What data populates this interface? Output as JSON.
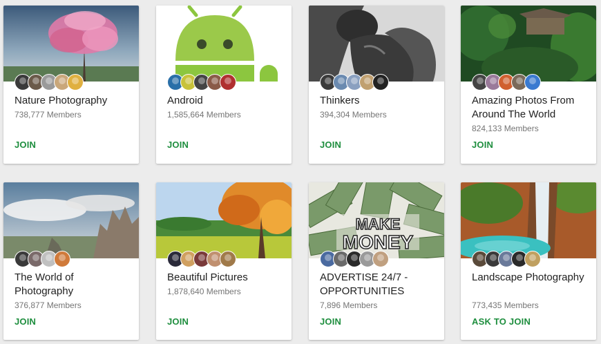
{
  "communities": [
    {
      "name": "Nature Photography",
      "members": "738,777 Members",
      "action": "JOIN",
      "image": "pink-blossom-tree",
      "avatar_colors": [
        "#3a3a3a",
        "#6b5a4a",
        "#9a9a9a",
        "#c9a77a",
        "#e0b040"
      ]
    },
    {
      "name": "Android",
      "members": "1,585,664 Members",
      "action": "JOIN",
      "image": "android-robot",
      "avatar_colors": [
        "#2a6fa8",
        "#c8c23a",
        "#444444",
        "#8a5a48",
        "#b03030"
      ]
    },
    {
      "name": "Thinkers",
      "members": "394,304 Members",
      "action": "JOIN",
      "image": "thinker-statue",
      "avatar_colors": [
        "#3a3a3a",
        "#6a8ab0",
        "#8aa0c0",
        "#c0a070",
        "#222222"
      ]
    },
    {
      "name": "Amazing Photos From Around The World",
      "members": "824,133 Members",
      "action": "JOIN",
      "image": "jungle-treehouse",
      "avatar_colors": [
        "#444444",
        "#9a7a9a",
        "#d06030",
        "#7a6a5a",
        "#3a7ad0"
      ]
    },
    {
      "name": "The World of Photography",
      "members": "376,877 Members",
      "action": "JOIN",
      "image": "mountain-clouds",
      "avatar_colors": [
        "#3a3a3a",
        "#7a6a6a",
        "#c0c0c0",
        "#d07a3a"
      ]
    },
    {
      "name": "Beautiful Pictures",
      "members": "1,878,640 Members",
      "action": "JOIN",
      "image": "autumn-tree",
      "avatar_colors": [
        "#2a2a3a",
        "#d0a060",
        "#7a3a3a",
        "#c09070",
        "#a07a4a"
      ]
    },
    {
      "name": "ADVERTISE 24/7 - OPPORTUNITIES",
      "members": "7,896 Members",
      "action": "JOIN",
      "image": "make-money",
      "avatar_colors": [
        "#4a6aa0",
        "#6a6a6a",
        "#2a2a2a",
        "#9a9a9a",
        "#c0a080"
      ]
    },
    {
      "name": "Landscape Photography",
      "members": "773,435 Members",
      "action": "ASK TO JOIN",
      "image": "waterfall",
      "avatar_colors": [
        "#5a4a3a",
        "#3a3a3a",
        "#6a7a9a",
        "#2a2a2a",
        "#c0a060"
      ]
    }
  ],
  "colors": {
    "accent": "#1e8e3e",
    "background": "#ececec",
    "card": "#ffffff"
  }
}
